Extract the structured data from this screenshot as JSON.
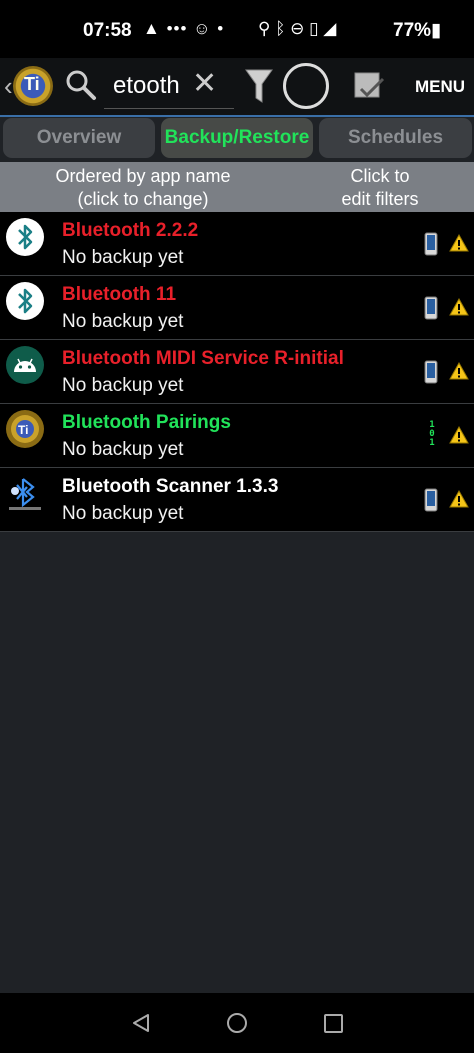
{
  "status_bar": {
    "time": "07:58",
    "battery": "77%",
    "icons": [
      "navigation-arrow",
      "more-dots",
      "waze-icon",
      "dot",
      "location-pin",
      "bluetooth",
      "do-not-disturb",
      "vibrate",
      "signal-5g",
      "battery"
    ]
  },
  "toolbar": {
    "search_value": "etooth",
    "menu_label": "MENU",
    "app_logo_letter": "Ti"
  },
  "tabs": [
    {
      "label": "Overview",
      "active": false
    },
    {
      "label": "Backup/Restore",
      "active": true
    },
    {
      "label": "Schedules",
      "active": false
    }
  ],
  "filter_header": {
    "order_line1": "Ordered by app name",
    "order_line2": "(click to change)",
    "filter_line1": "Click to",
    "filter_line2": "edit filters"
  },
  "apps": [
    {
      "name": "Bluetooth 2.2.2",
      "status": "No backup yet",
      "name_color": "#e8202a",
      "icon": "bluetooth-icon",
      "storage": "phone-icon"
    },
    {
      "name": "Bluetooth 11",
      "status": "No backup yet",
      "name_color": "#e8202a",
      "icon": "bluetooth-icon",
      "storage": "phone-icon"
    },
    {
      "name": "Bluetooth MIDI Service R-initial",
      "status": "No backup yet",
      "name_color": "#e8202a",
      "icon": "android-icon",
      "storage": "phone-icon"
    },
    {
      "name": "Bluetooth Pairings",
      "status": "No backup yet",
      "name_color": "#21e35a",
      "icon": "titanium-icon",
      "storage": "binary-icon",
      "binary": "101"
    },
    {
      "name": "Bluetooth Scanner 1.3.3",
      "status": "No backup yet",
      "name_color": "#ffffff",
      "icon": "bluetooth-discover-icon",
      "storage": "phone-icon"
    }
  ],
  "colors": {
    "active_tab_text": "#21e35a",
    "warning": "#f5c518",
    "toolbar_border": "#3a6fa8"
  }
}
